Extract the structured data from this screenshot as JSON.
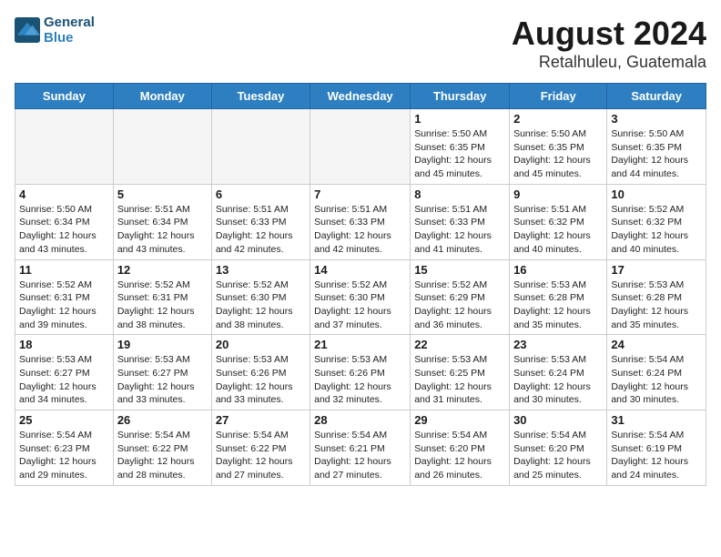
{
  "header": {
    "logo_line1": "General",
    "logo_line2": "Blue",
    "title": "August 2024",
    "subtitle": "Retalhuleu, Guatemala"
  },
  "weekdays": [
    "Sunday",
    "Monday",
    "Tuesday",
    "Wednesday",
    "Thursday",
    "Friday",
    "Saturday"
  ],
  "weeks": [
    [
      {
        "day": "",
        "info": ""
      },
      {
        "day": "",
        "info": ""
      },
      {
        "day": "",
        "info": ""
      },
      {
        "day": "",
        "info": ""
      },
      {
        "day": "1",
        "info": "Sunrise: 5:50 AM\nSunset: 6:35 PM\nDaylight: 12 hours\nand 45 minutes."
      },
      {
        "day": "2",
        "info": "Sunrise: 5:50 AM\nSunset: 6:35 PM\nDaylight: 12 hours\nand 45 minutes."
      },
      {
        "day": "3",
        "info": "Sunrise: 5:50 AM\nSunset: 6:35 PM\nDaylight: 12 hours\nand 44 minutes."
      }
    ],
    [
      {
        "day": "4",
        "info": "Sunrise: 5:50 AM\nSunset: 6:34 PM\nDaylight: 12 hours\nand 43 minutes."
      },
      {
        "day": "5",
        "info": "Sunrise: 5:51 AM\nSunset: 6:34 PM\nDaylight: 12 hours\nand 43 minutes."
      },
      {
        "day": "6",
        "info": "Sunrise: 5:51 AM\nSunset: 6:33 PM\nDaylight: 12 hours\nand 42 minutes."
      },
      {
        "day": "7",
        "info": "Sunrise: 5:51 AM\nSunset: 6:33 PM\nDaylight: 12 hours\nand 42 minutes."
      },
      {
        "day": "8",
        "info": "Sunrise: 5:51 AM\nSunset: 6:33 PM\nDaylight: 12 hours\nand 41 minutes."
      },
      {
        "day": "9",
        "info": "Sunrise: 5:51 AM\nSunset: 6:32 PM\nDaylight: 12 hours\nand 40 minutes."
      },
      {
        "day": "10",
        "info": "Sunrise: 5:52 AM\nSunset: 6:32 PM\nDaylight: 12 hours\nand 40 minutes."
      }
    ],
    [
      {
        "day": "11",
        "info": "Sunrise: 5:52 AM\nSunset: 6:31 PM\nDaylight: 12 hours\nand 39 minutes."
      },
      {
        "day": "12",
        "info": "Sunrise: 5:52 AM\nSunset: 6:31 PM\nDaylight: 12 hours\nand 38 minutes."
      },
      {
        "day": "13",
        "info": "Sunrise: 5:52 AM\nSunset: 6:30 PM\nDaylight: 12 hours\nand 38 minutes."
      },
      {
        "day": "14",
        "info": "Sunrise: 5:52 AM\nSunset: 6:30 PM\nDaylight: 12 hours\nand 37 minutes."
      },
      {
        "day": "15",
        "info": "Sunrise: 5:52 AM\nSunset: 6:29 PM\nDaylight: 12 hours\nand 36 minutes."
      },
      {
        "day": "16",
        "info": "Sunrise: 5:53 AM\nSunset: 6:28 PM\nDaylight: 12 hours\nand 35 minutes."
      },
      {
        "day": "17",
        "info": "Sunrise: 5:53 AM\nSunset: 6:28 PM\nDaylight: 12 hours\nand 35 minutes."
      }
    ],
    [
      {
        "day": "18",
        "info": "Sunrise: 5:53 AM\nSunset: 6:27 PM\nDaylight: 12 hours\nand 34 minutes."
      },
      {
        "day": "19",
        "info": "Sunrise: 5:53 AM\nSunset: 6:27 PM\nDaylight: 12 hours\nand 33 minutes."
      },
      {
        "day": "20",
        "info": "Sunrise: 5:53 AM\nSunset: 6:26 PM\nDaylight: 12 hours\nand 33 minutes."
      },
      {
        "day": "21",
        "info": "Sunrise: 5:53 AM\nSunset: 6:26 PM\nDaylight: 12 hours\nand 32 minutes."
      },
      {
        "day": "22",
        "info": "Sunrise: 5:53 AM\nSunset: 6:25 PM\nDaylight: 12 hours\nand 31 minutes."
      },
      {
        "day": "23",
        "info": "Sunrise: 5:53 AM\nSunset: 6:24 PM\nDaylight: 12 hours\nand 30 minutes."
      },
      {
        "day": "24",
        "info": "Sunrise: 5:54 AM\nSunset: 6:24 PM\nDaylight: 12 hours\nand 30 minutes."
      }
    ],
    [
      {
        "day": "25",
        "info": "Sunrise: 5:54 AM\nSunset: 6:23 PM\nDaylight: 12 hours\nand 29 minutes."
      },
      {
        "day": "26",
        "info": "Sunrise: 5:54 AM\nSunset: 6:22 PM\nDaylight: 12 hours\nand 28 minutes."
      },
      {
        "day": "27",
        "info": "Sunrise: 5:54 AM\nSunset: 6:22 PM\nDaylight: 12 hours\nand 27 minutes."
      },
      {
        "day": "28",
        "info": "Sunrise: 5:54 AM\nSunset: 6:21 PM\nDaylight: 12 hours\nand 27 minutes."
      },
      {
        "day": "29",
        "info": "Sunrise: 5:54 AM\nSunset: 6:20 PM\nDaylight: 12 hours\nand 26 minutes."
      },
      {
        "day": "30",
        "info": "Sunrise: 5:54 AM\nSunset: 6:20 PM\nDaylight: 12 hours\nand 25 minutes."
      },
      {
        "day": "31",
        "info": "Sunrise: 5:54 AM\nSunset: 6:19 PM\nDaylight: 12 hours\nand 24 minutes."
      }
    ]
  ]
}
